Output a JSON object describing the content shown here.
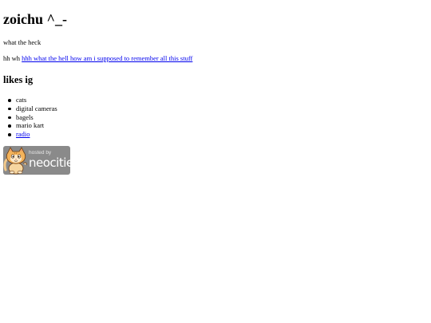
{
  "header": {
    "title": "zoichu ^_-"
  },
  "intro": {
    "subtitle": "what the heck",
    "prefix_text": "hh wh",
    "link_text": "hhh what the hell how am i supposed to remember all this stuff"
  },
  "likes": {
    "heading": "likes ig",
    "items": [
      {
        "label": "cats",
        "is_link": false
      },
      {
        "label": "digital cameras",
        "is_link": false
      },
      {
        "label": "bagels",
        "is_link": false
      },
      {
        "label": "mario kart",
        "is_link": false
      },
      {
        "label": "radio",
        "is_link": true
      }
    ]
  },
  "badge": {
    "hosted_label": "hosted by",
    "brand_label": "neocities",
    "icon": "neocities-cat-icon"
  },
  "colors": {
    "link": "#0000ee",
    "text": "#000000",
    "background": "#ffffff",
    "badge_bg": "#8a8a8a"
  }
}
